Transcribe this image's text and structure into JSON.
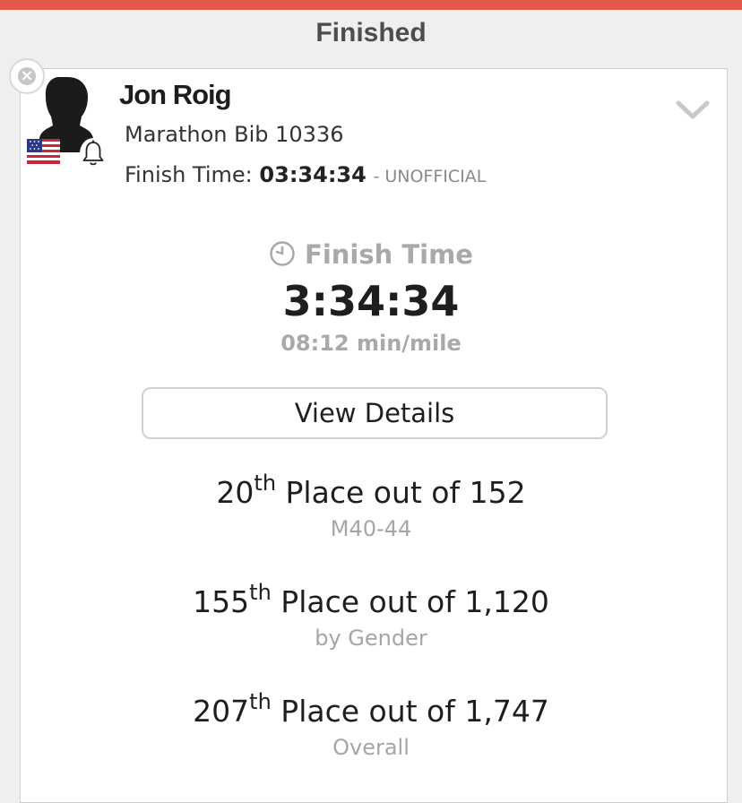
{
  "section_title": "Finished",
  "runner": {
    "name": "Jon Roig",
    "bib": "Marathon Bib 10336",
    "finish_label": "Finish Time:",
    "finish_value": "03:34:34",
    "finish_status": "- UNOFFICIAL"
  },
  "result": {
    "header": "Finish Time",
    "time": "3:34:34",
    "pace": "08:12 min/mile",
    "details_button": "View Details"
  },
  "placements": [
    {
      "rank": "20",
      "suffix": "th",
      "text": "Place out of 152",
      "category": "M40-44"
    },
    {
      "rank": "155",
      "suffix": "th",
      "text": "Place out of 1,120",
      "category": "by Gender"
    },
    {
      "rank": "207",
      "suffix": "th",
      "text": "Place out of 1,747",
      "category": "Overall"
    }
  ],
  "icons": {
    "close": "close-circle-icon",
    "avatar": "user-silhouette-icon",
    "flag": "us-flag-icon",
    "bell": "bell-icon",
    "expand": "chevron-down-icon",
    "clock": "clock-icon"
  },
  "colors": {
    "accent": "#e5574a",
    "background": "#efefef",
    "muted_text": "#a9a9a9"
  }
}
